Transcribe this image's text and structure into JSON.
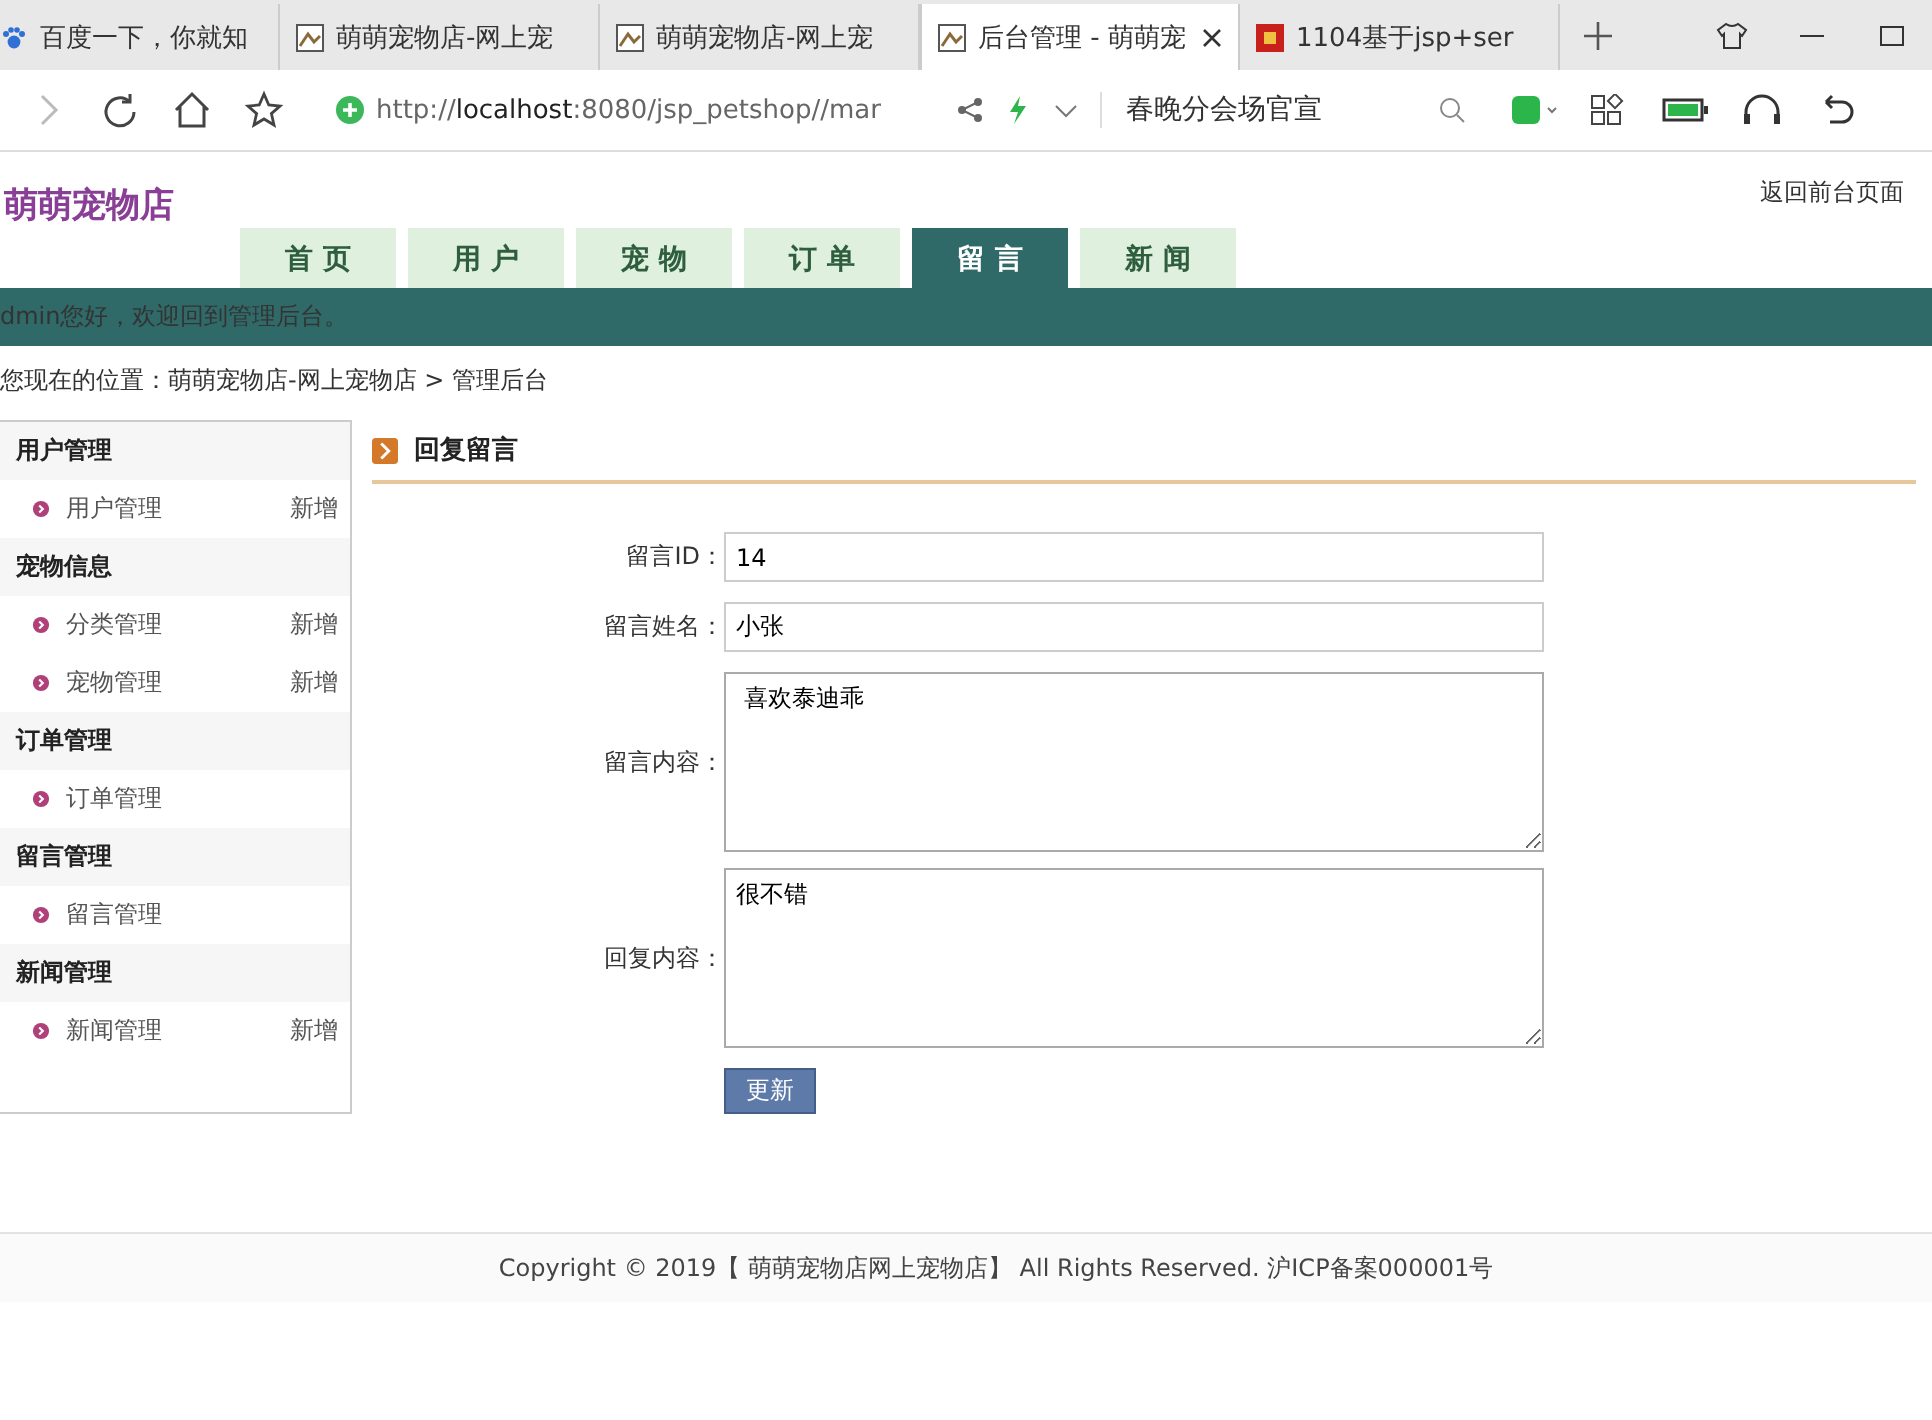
{
  "browser": {
    "tabs": [
      {
        "title": "百度一下，你就知",
        "selected": false,
        "kind": "paw"
      },
      {
        "title": "萌萌宠物店-网上宠",
        "selected": false,
        "kind": "page"
      },
      {
        "title": "萌萌宠物店-网上宠",
        "selected": false,
        "kind": "page"
      },
      {
        "title": "后台管理 - 萌萌宠",
        "selected": true,
        "kind": "page"
      },
      {
        "title": "1104基于jsp+ser",
        "selected": false,
        "kind": "red"
      }
    ],
    "address": {
      "prefix": "http://",
      "host": "localhost",
      "rest": ":8080/jsp_petshop//mar"
    },
    "search": {
      "value": "春晚分会场官宣"
    }
  },
  "header": {
    "logo": "萌萌宠物店",
    "back_link": "返回前台页面",
    "nav": [
      {
        "label": "首 页",
        "selected": false
      },
      {
        "label": "用 户",
        "selected": false
      },
      {
        "label": "宠 物",
        "selected": false
      },
      {
        "label": "订 单",
        "selected": false
      },
      {
        "label": "留 言",
        "selected": true
      },
      {
        "label": "新 闻",
        "selected": false
      }
    ],
    "welcome": "dmin您好，欢迎回到管理后台。"
  },
  "breadcrumb": "您现在的位置：萌萌宠物店-网上宠物店 > 管理后台",
  "sidebar": {
    "groups": [
      {
        "title": "用户管理",
        "items": [
          {
            "label": "用户管理",
            "action": "新增"
          }
        ]
      },
      {
        "title": "宠物信息",
        "items": [
          {
            "label": "分类管理",
            "action": "新增"
          },
          {
            "label": "宠物管理",
            "action": "新增"
          }
        ]
      },
      {
        "title": "订单管理",
        "items": [
          {
            "label": "订单管理"
          }
        ]
      },
      {
        "title": "留言管理",
        "items": [
          {
            "label": "留言管理"
          }
        ]
      },
      {
        "title": "新闻管理",
        "items": [
          {
            "label": "新闻管理",
            "action": "新增"
          }
        ]
      }
    ]
  },
  "panel": {
    "title": "回复留言",
    "fields": [
      {
        "label": "留言ID：",
        "value": "14",
        "kind": "input"
      },
      {
        "label": "留言姓名：",
        "value": "小张",
        "kind": "input"
      },
      {
        "label": "留言内容：",
        "value": " 喜欢泰迪乖",
        "kind": "textarea"
      },
      {
        "label": "回复内容：",
        "value": "很不错",
        "kind": "textarea"
      }
    ],
    "submit": "更新"
  },
  "footer": "Copyright © 2019【 萌萌宠物店网上宠物店】 All Rights Reserved. 沪ICP备案000001号"
}
